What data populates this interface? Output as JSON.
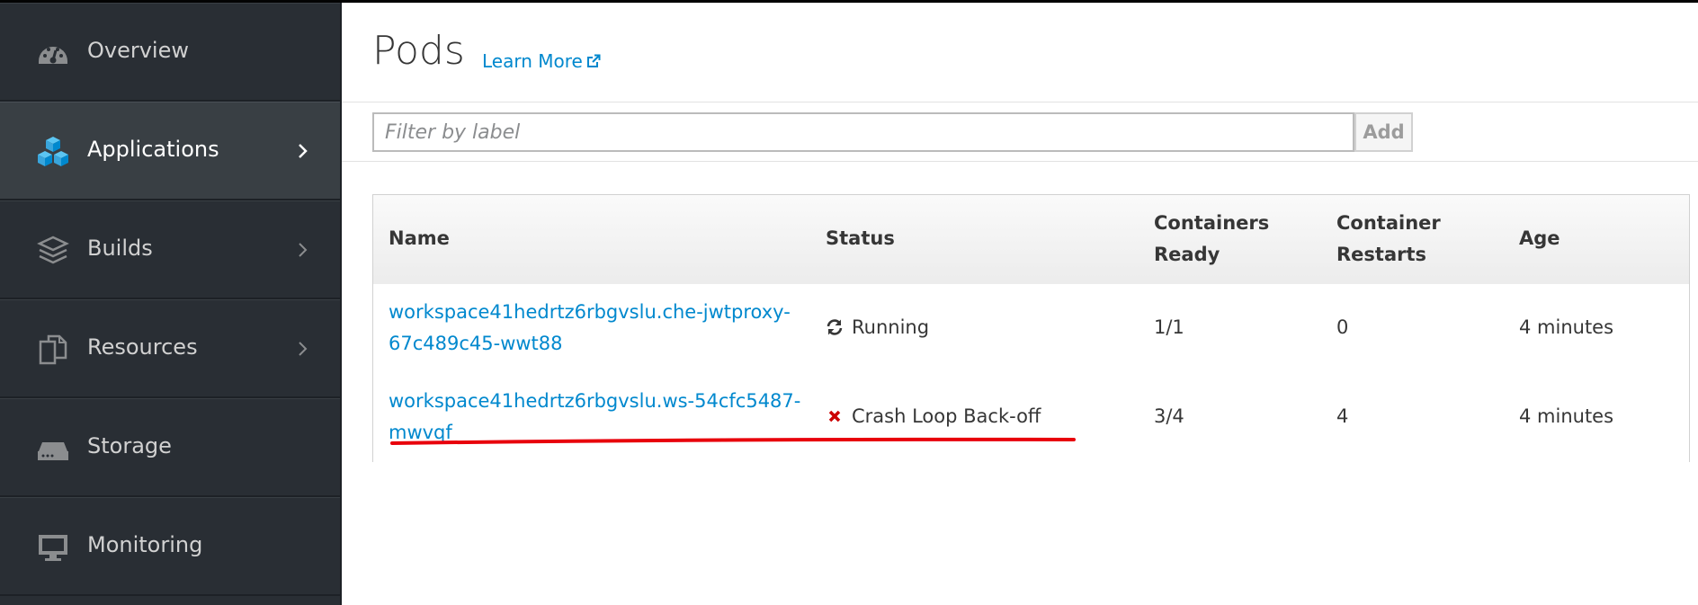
{
  "sidebar": {
    "items": [
      {
        "label": "Overview",
        "icon": "dashboard-gauge-icon"
      },
      {
        "label": "Applications",
        "icon": "cubes-icon",
        "active": true
      },
      {
        "label": "Builds",
        "icon": "layers-icon"
      },
      {
        "label": "Resources",
        "icon": "resources-icon"
      },
      {
        "label": "Storage",
        "icon": "storage-drive-icon"
      },
      {
        "label": "Monitoring",
        "icon": "monitor-icon"
      }
    ]
  },
  "header": {
    "title": "Pods",
    "learn_more": "Learn More"
  },
  "filter": {
    "placeholder": "Filter by label",
    "add_label": "Add"
  },
  "table": {
    "columns": {
      "name": "Name",
      "status": "Status",
      "containers_ready_1": "Containers",
      "containers_ready_2": "Ready",
      "restarts_1": "Container",
      "restarts_2": "Restarts",
      "age": "Age"
    },
    "rows": [
      {
        "name_line1": "workspace41hedrtz6rbgvslu.che-jwtproxy-",
        "name_line2": "67c489c45-wwt88",
        "status": "Running",
        "status_icon": "refresh-icon",
        "containers_ready": "1/1",
        "restarts": "0",
        "age": "4 minutes"
      },
      {
        "name_line1": "workspace41hedrtz6rbgvslu.ws-54cfc5487-",
        "name_line2": "mwvqf",
        "status": "Crash Loop Back-off",
        "status_icon": "error-x-icon",
        "containers_ready": "3/4",
        "restarts": "4",
        "age": "4 minutes"
      }
    ]
  },
  "colors": {
    "sidebar_bg": "#292e34",
    "sidebar_active": "#393f44",
    "link": "#0088ce",
    "error": "#cc0000",
    "annotation": "#e8000b"
  }
}
